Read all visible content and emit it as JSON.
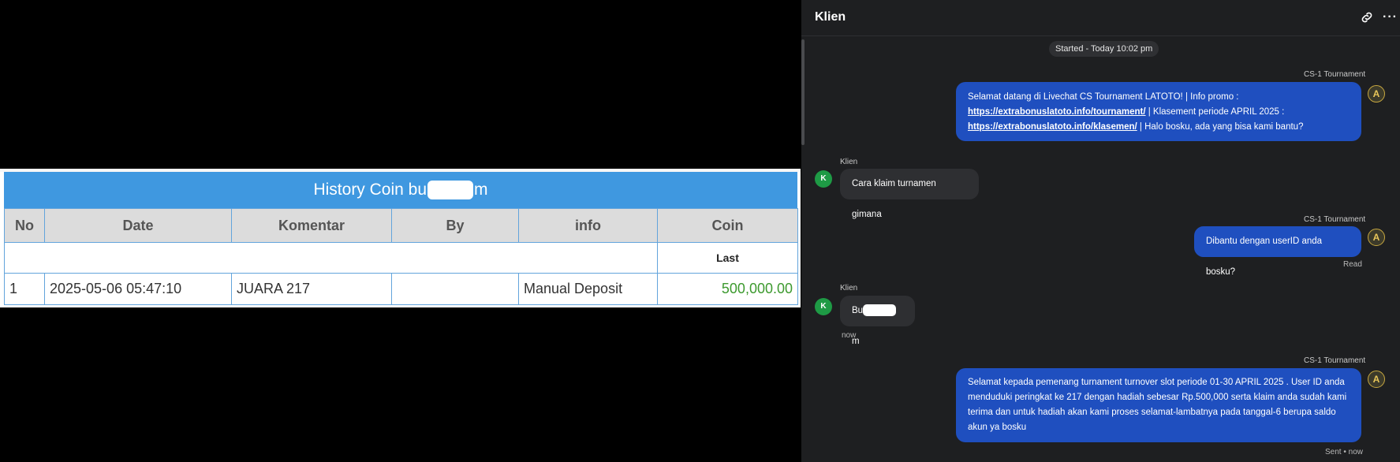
{
  "history": {
    "title_prefix": "History Coin bu",
    "title_suffix": "m",
    "columns": [
      "No",
      "Date",
      "Komentar",
      "By",
      "info",
      "Coin"
    ],
    "subheader_last": "Last",
    "rows": [
      {
        "no": "1",
        "date": "2025-05-06 05:47:10",
        "komentar": "JUARA 217",
        "by": "",
        "info": "Manual Deposit",
        "coin": "500,000.00"
      }
    ]
  },
  "chat": {
    "title": "Klien",
    "started": "Started - Today 10:02 pm",
    "messages": [
      {
        "sender": "CS-1 Tournament",
        "line1": "Selamat datang di Livechat CS Tournament LATOTO! | Info promo :",
        "link1": "https://extrabonuslatoto.info/tournament/",
        "line2_after": " | Klasement periode APRIL 2025 :",
        "link2": "https://extrabonuslatoto.info/klasemen/",
        "line3_after": " | Halo bosku, ada yang bisa kami bantu?"
      },
      {
        "sender": "Klien",
        "text": "Cara klaim turnamen gimana"
      },
      {
        "sender": "CS-1 Tournament",
        "text": "Dibantu dengan userID anda bosku?",
        "status": "Read"
      },
      {
        "sender": "Klien",
        "text_prefix": "Bu",
        "text_suffix": "m",
        "time": "now"
      },
      {
        "sender": "CS-1 Tournament",
        "lines": [
          "Selamat kepada pemenang turnament turnover slot periode 01-30 APRIL 2025 . User ID anda",
          "menduduki peringkat ke 217 dengan hadiah sebesar Rp.500,000 serta klaim anda sudah kami",
          "terima dan untuk hadiah akan kami proses selamat-lambatnya pada tanggal-6 berupa saldo",
          "akun ya bosku"
        ],
        "status": "Sent • now"
      }
    ],
    "client_initial": "K",
    "agent_initial": "A"
  }
}
